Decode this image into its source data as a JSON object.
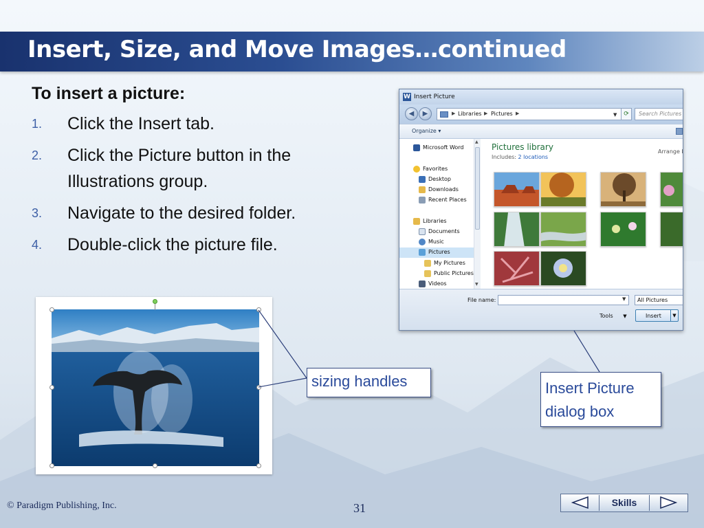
{
  "slide": {
    "title": "Insert, Size, and Move Images…continued",
    "heading": "To insert a picture:",
    "steps": [
      {
        "num": "1.",
        "text": "Click the Insert tab."
      },
      {
        "num": "2.",
        "text": "Click the Picture button in the Illustrations group."
      },
      {
        "num": "3.",
        "text": "Navigate to the desired folder."
      },
      {
        "num": "4.",
        "text": "Double-click the picture file."
      }
    ],
    "callout_sizing": "sizing handles",
    "callout_dialog": "Insert Picture dialog box"
  },
  "dialog": {
    "title": "Insert Picture",
    "breadcrumb": [
      "Libraries",
      "Pictures"
    ],
    "search_placeholder": "Search Pictures",
    "organize": "Organize ▾",
    "nav_items": [
      "Microsoft Word",
      "Favorites",
      "Desktop",
      "Downloads",
      "Recent Places",
      "Libraries",
      "Documents",
      "Music",
      "Pictures",
      "My Pictures",
      "Public Pictures",
      "Videos"
    ],
    "library_title": "Pictures library",
    "includes_label": "Includes:",
    "includes_link": "2 locations",
    "arrange_label": "Arrange b",
    "file_name_label": "File name:",
    "file_name_value": "",
    "filter_value": "All Pictures",
    "tools_label": "Tools",
    "insert_label": "Insert"
  },
  "footer": {
    "copyright": "© Paradigm Publishing, Inc.",
    "page_number": "31",
    "skills_label": "Skills"
  },
  "colors": {
    "title_bar": "#2b4e92",
    "step_number": "#3d5fa6",
    "callout_text": "#2a4a9a"
  }
}
